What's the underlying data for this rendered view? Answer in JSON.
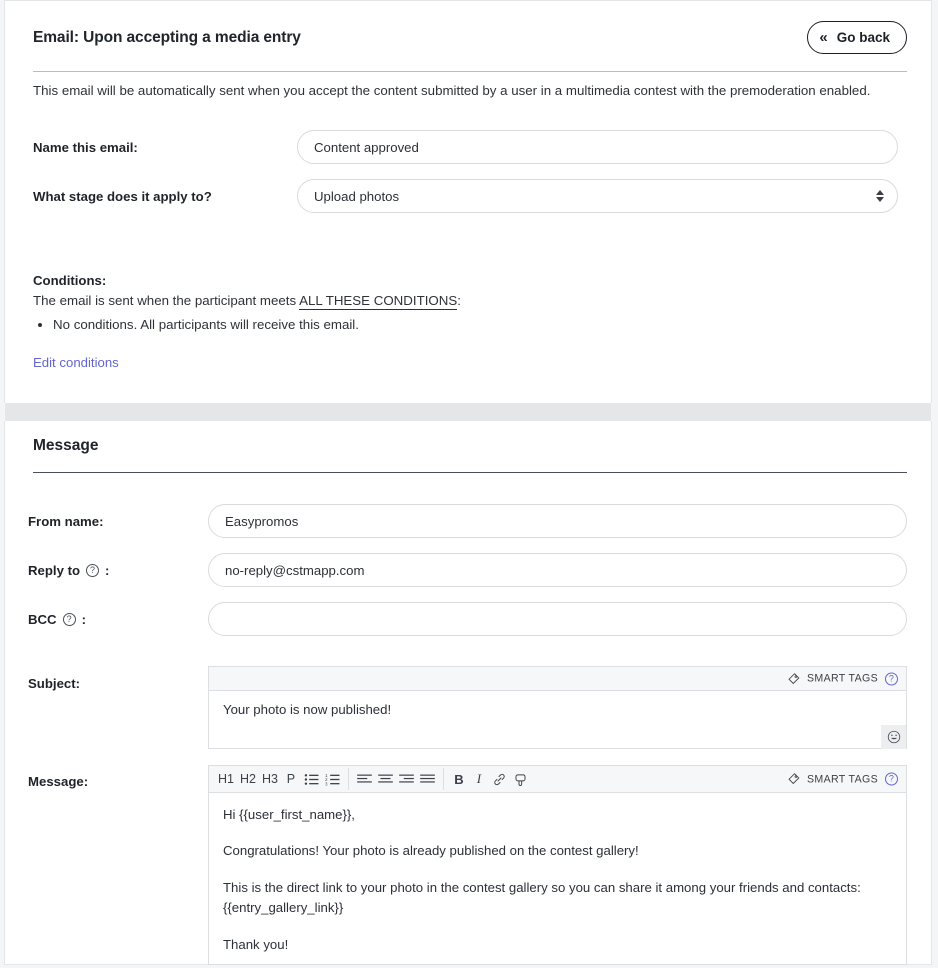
{
  "header": {
    "title": "Email: Upon accepting a media entry",
    "go_back_label": "Go back",
    "go_back_icon": "double-chevron-left-icon"
  },
  "intro": "This email will be automatically sent when you accept the content submitted by a user in a multimedia contest with the premoderation enabled.",
  "form": {
    "name_label": "Name this email:",
    "name_value": "Content approved",
    "stage_label": "What stage does it apply to?",
    "stage_value": "Upload photos"
  },
  "conditions": {
    "title": "Conditions:",
    "sentence_prefix": "The email is sent when the participant meets ",
    "sentence_emphasis": "ALL THESE CONDITIONS",
    "sentence_suffix": ":",
    "items": [
      "No conditions. All participants will receive this email."
    ],
    "edit_link": "Edit conditions"
  },
  "message_section": {
    "title": "Message",
    "from_label": "From name:",
    "from_value": "Easypromos",
    "reply_label": "Reply to",
    "reply_suffix": ":",
    "reply_value": "no-reply@cstmapp.com",
    "bcc_label": "BCC",
    "bcc_suffix": ":",
    "bcc_value": "",
    "subject_label": "Subject:",
    "subject_value": "Your photo is now published!",
    "message_label": "Message:",
    "smart_tags_label": "SMART TAGS",
    "help_glyph": "?",
    "emoji_glyph": "emoji-smiley-icon"
  },
  "editor_toolbar": [
    {
      "name": "heading-1-button",
      "label": "H1"
    },
    {
      "name": "heading-2-button",
      "label": "H2"
    },
    {
      "name": "heading-3-button",
      "label": "H3"
    },
    {
      "name": "paragraph-button",
      "label": "P"
    },
    {
      "name": "bullet-list-button",
      "label": ""
    },
    {
      "name": "numbered-list-button",
      "label": ""
    },
    {
      "name": "align-left-button",
      "label": ""
    },
    {
      "name": "align-center-button",
      "label": ""
    },
    {
      "name": "align-right-button",
      "label": ""
    },
    {
      "name": "align-justify-button",
      "label": ""
    },
    {
      "name": "bold-button",
      "label": "B"
    },
    {
      "name": "italic-button",
      "label": "I"
    },
    {
      "name": "insert-link-button",
      "label": ""
    },
    {
      "name": "unlink-button",
      "label": ""
    }
  ],
  "message_body": [
    "Hi {{user_first_name}},",
    "Congratulations! Your photo is already published on the contest gallery!",
    "This is the direct link to your photo in the contest gallery so you can share it among your friends and contacts: {{entry_gallery_link}}",
    "Thank you!"
  ],
  "colors": {
    "link": "#6366cf",
    "text": "#2e3238",
    "panel_border": "#e3e5e8",
    "band": "#e4e6e8"
  }
}
